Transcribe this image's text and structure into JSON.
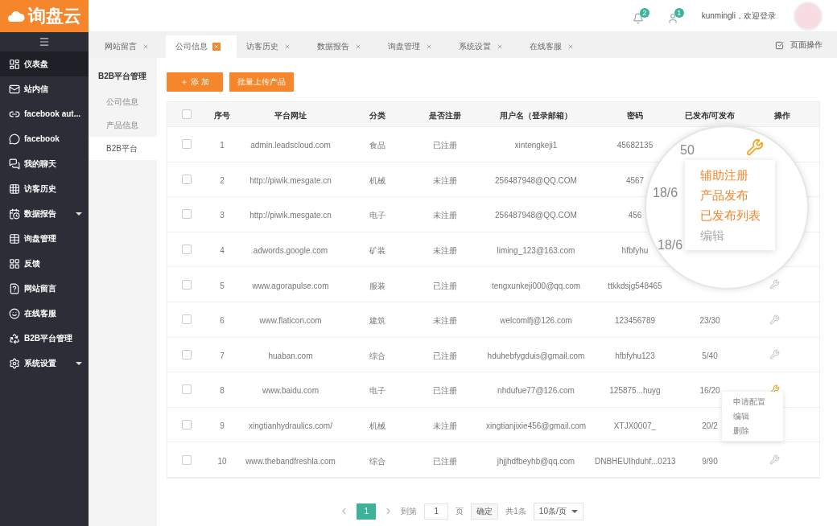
{
  "logo": {
    "text": "询盘云"
  },
  "header": {
    "notifications": [
      {
        "count": "2"
      },
      {
        "count": "1"
      }
    ],
    "greeting": "kunmingli，欢迎登录"
  },
  "sidebar": {
    "items": [
      {
        "label": "仪表盘",
        "selected": true,
        "expandable": false
      },
      {
        "label": "站内信",
        "selected": false,
        "expandable": false
      },
      {
        "label": "facebook aut...",
        "selected": false,
        "expandable": false
      },
      {
        "label": "facebook",
        "selected": false,
        "expandable": false
      },
      {
        "label": "我的聊天",
        "selected": false,
        "expandable": false
      },
      {
        "label": "访客历史",
        "selected": false,
        "expandable": false
      },
      {
        "label": "数据报告",
        "selected": false,
        "expandable": true
      },
      {
        "label": "询盘管理",
        "selected": false,
        "expandable": false
      },
      {
        "label": "反馈",
        "selected": false,
        "expandable": false
      },
      {
        "label": "网站留言",
        "selected": false,
        "expandable": false
      },
      {
        "label": "在线客服",
        "selected": false,
        "expandable": false
      },
      {
        "label": "B2B平台管理",
        "selected": false,
        "expandable": false
      },
      {
        "label": "系统设置",
        "selected": false,
        "expandable": true
      }
    ]
  },
  "tabs": [
    {
      "label": "网站留言",
      "selected": false
    },
    {
      "label": "公司信息",
      "selected": true
    },
    {
      "label": "访客历史",
      "selected": false
    },
    {
      "label": "数据报告",
      "selected": false
    },
    {
      "label": "询盘管理",
      "selected": false
    },
    {
      "label": "系统设置",
      "selected": false
    },
    {
      "label": "在线客服",
      "selected": false
    }
  ],
  "page_actions": "页面操作",
  "submenu": {
    "title": "B2B平台管理",
    "items": [
      {
        "label": "公司信息",
        "selected": false
      },
      {
        "label": "产品信息",
        "selected": false
      },
      {
        "label": "B2B平台",
        "selected": true
      }
    ]
  },
  "toolbar": {
    "buttons": [
      "＋ 添 加",
      "批量上传产品"
    ]
  },
  "table": {
    "select_all": {
      "checked": false
    },
    "columns": [
      "序号",
      "平台网址",
      "分类",
      "是否注册",
      "用户名（登录邮箱）",
      "密码",
      "已发布/可发布",
      "操作"
    ],
    "rows": [
      {
        "checked": false,
        "no": "1",
        "url": "admin.leadscloud.com",
        "category": "食品",
        "registered": "已注册",
        "user": "xintengkeji1",
        "password": "45682135"
      },
      {
        "checked": false,
        "no": "2",
        "url": "http://piwik.mesgate.cn",
        "category": "机械",
        "registered": "未注册",
        "user": "256487948@QQ.COM",
        "password": "4567"
      },
      {
        "checked": false,
        "no": "3",
        "url": "http://piwik.mesgate.cn",
        "category": "电子",
        "registered": "未注册",
        "user": "256487948@QQ.COM",
        "password": "456"
      },
      {
        "checked": false,
        "no": "4",
        "url": "adwords.google.com",
        "category": "矿装",
        "registered": "未注册",
        "user": "liming_123@163.com",
        "password": "hfbfyhu"
      },
      {
        "checked": false,
        "no": "5",
        "url": "www.agorapulse.com",
        "category": "服装",
        "registered": "已注册",
        "user": "tengxunkeji000@qq.com",
        "password": "ttkkdsjg548465",
        "action": {
          "active": false
        }
      },
      {
        "checked": false,
        "no": "6",
        "url": "www.flaticon.com",
        "category": "建筑",
        "registered": "未注册",
        "user": "welcomlfj@126.com",
        "password": "123456789",
        "published": "23/30",
        "action": {
          "active": false
        }
      },
      {
        "checked": false,
        "no": "7",
        "url": "huaban.com",
        "category": "综合",
        "registered": "已注册",
        "user": "hduhebfygduis@gmail.com",
        "password": "hfbfyhu123",
        "published": "5/40",
        "action": {
          "active": false
        }
      },
      {
        "checked": false,
        "no": "8",
        "url": "www.baidu.com",
        "category": "电子",
        "registered": "已注册",
        "user": "nhdufue77@126.com",
        "password": "125875...huyg",
        "published": "16/20",
        "action": {
          "active": true
        }
      },
      {
        "checked": false,
        "no": "9",
        "url": "xingtianhydraulics.com/",
        "category": "机械",
        "registered": "未注册",
        "user": "xingtianjixie456@gmail.com",
        "password": "XTJX0007_",
        "published": "20/2"
      },
      {
        "checked": false,
        "no": "10",
        "url": "www.thebandfreshla.com",
        "category": "综合",
        "registered": "已注册",
        "user": "jhjjhdfbeyhb@qq.com",
        "password": "DNBHEUIhduhf...0213",
        "published": "9/90",
        "action": {
          "active": false
        }
      }
    ]
  },
  "row_menu": {
    "items": [
      "申请配置",
      "编辑",
      "删除"
    ]
  },
  "magnifier": {
    "readings": [
      "50",
      "18/6",
      "18/6"
    ],
    "menu": [
      {
        "label": "辅助注册",
        "kind": "primary"
      },
      {
        "label": "产品发布",
        "kind": "primary"
      },
      {
        "label": "已发布列表",
        "kind": "primary"
      },
      {
        "label": "编辑",
        "kind": "plain"
      }
    ]
  },
  "pagination": {
    "pages": [
      {
        "label": "1",
        "selected": true
      }
    ],
    "goto_label": "到第",
    "goto_value": "1",
    "page_unit": "页",
    "confirm": "确定",
    "total": "共1条",
    "page_size": "10条/页"
  }
}
